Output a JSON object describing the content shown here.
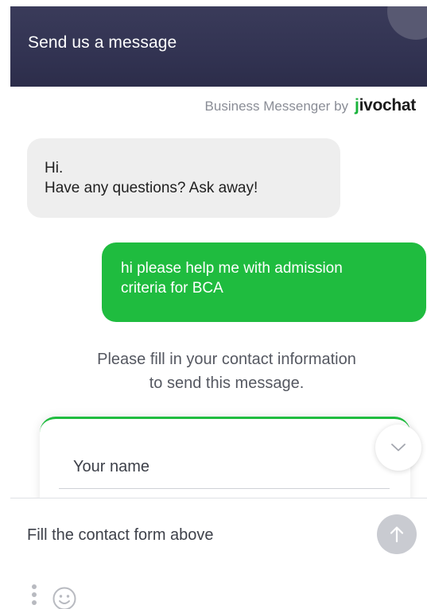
{
  "header": {
    "title": "Send us a message"
  },
  "branding": {
    "text": "Business Messenger by",
    "logo_prefix": "j",
    "logo_rest": "ivochat"
  },
  "conversation": {
    "agent_message": {
      "line1": "Hi.",
      "line2": "Have any questions? Ask away!"
    },
    "user_message": {
      "line1": "hi please help me with admission",
      "line2": "criteria for BCA"
    },
    "notice": {
      "line1": "Please fill in your contact information",
      "line2": "to send this message."
    }
  },
  "contact_form": {
    "name_placeholder": "Your name"
  },
  "composer": {
    "placeholder": "Fill the contact form above"
  },
  "icons": {
    "scroll": "chevron-down-icon",
    "send": "arrow-up-icon",
    "more": "vertical-dots-icon",
    "emoji": "smiley-icon"
  },
  "colors": {
    "header_bg": "#323352",
    "user_bubble": "#1fbc3f",
    "agent_bubble": "#eeeeee",
    "brand_green": "#18b23a",
    "send_disabled": "#c9cbd1"
  }
}
